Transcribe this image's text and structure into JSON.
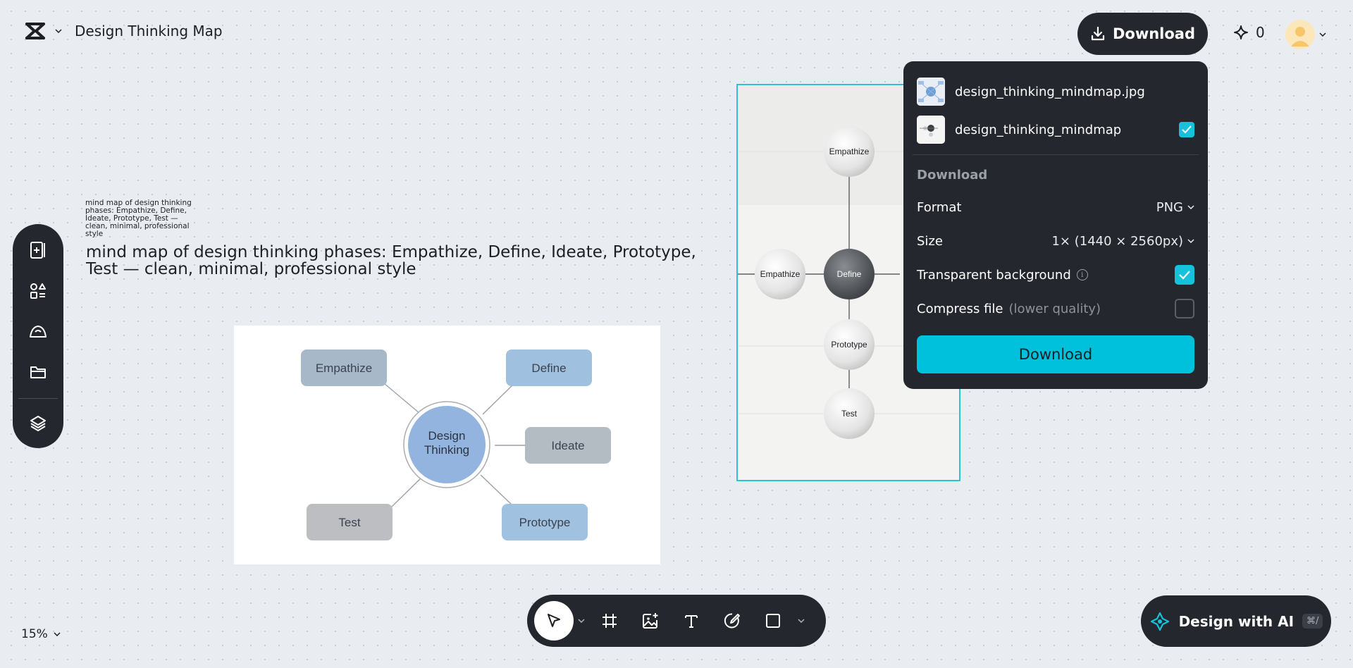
{
  "header": {
    "project_title": "Design Thinking Map",
    "download_label": "Download",
    "credits_count": "0"
  },
  "canvas": {
    "prompt_small": "mind map of design thinking phases: Empathize, Define, Ideate, Prototype, Test — clean, minimal, professional style",
    "prompt_large": "mind map of design thinking phases: Empathize, Define, Ideate, Prototype, Test — clean, minimal, professional style",
    "mindmap": {
      "center": [
        "Design",
        "Thinking"
      ],
      "nodes": [
        "Empathize",
        "Define",
        "Ideate",
        "Prototype",
        "Test"
      ]
    },
    "image2": {
      "nodes": [
        "Empathize",
        "Empathize",
        "Define",
        "Prototype",
        "Test"
      ]
    }
  },
  "download_panel": {
    "files": [
      {
        "name": "design_thinking_mindmap.jpg",
        "checked": false
      },
      {
        "name": "design_thinking_mindmap",
        "checked": true
      }
    ],
    "section_title": "Download",
    "format_label": "Format",
    "format_value": "PNG",
    "size_label": "Size",
    "size_value": "1× (1440 × 2560px)",
    "transparent_label": "Transparent background",
    "transparent_checked": true,
    "compress_label": "Compress file",
    "compress_note": "(lower quality)",
    "compress_checked": false,
    "download_button": "Download"
  },
  "footer": {
    "zoom": "15%",
    "ai_button": "Design with AI",
    "ai_shortcut": "⌘/"
  },
  "colors": {
    "accent": "#00c1dc",
    "dark_surface": "#24272d",
    "canvas_bg": "#e9edf2"
  }
}
